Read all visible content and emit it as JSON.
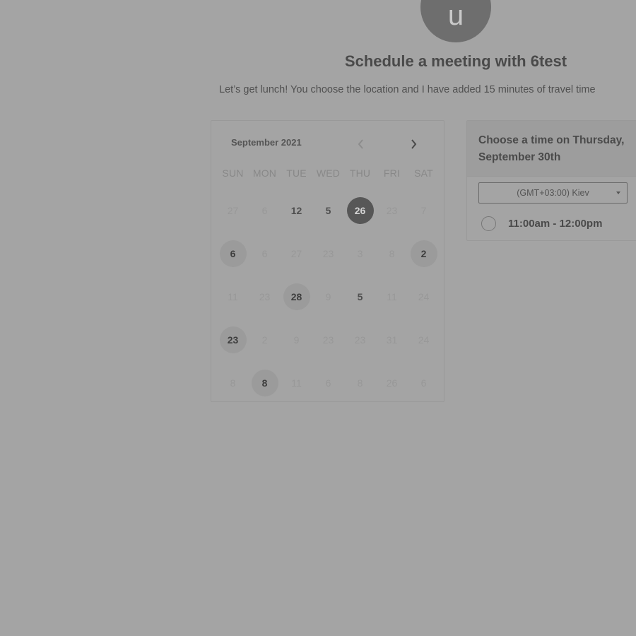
{
  "header": {
    "avatar_letter": "u",
    "title": "Schedule a meeting with 6test",
    "description": "Let’s get lunch! You choose the location and I have added 15 minutes of travel time"
  },
  "calendar": {
    "month": "September 2021",
    "prev_icon": "chevron-left-icon",
    "next_icon": "chevron-right-icon",
    "weekdays": [
      "SUN",
      "MON",
      "TUE",
      "WED",
      "THU",
      "FRI",
      "SAT"
    ],
    "weeks": [
      [
        {
          "d": "27",
          "s": "off"
        },
        {
          "d": "6",
          "s": "off"
        },
        {
          "d": "12",
          "s": "norm"
        },
        {
          "d": "5",
          "s": "norm"
        },
        {
          "d": "26",
          "s": "sel"
        },
        {
          "d": "23",
          "s": "off"
        },
        {
          "d": "7",
          "s": "off"
        }
      ],
      [
        {
          "d": "6",
          "s": "avail"
        },
        {
          "d": "6",
          "s": "off"
        },
        {
          "d": "27",
          "s": "off"
        },
        {
          "d": "23",
          "s": "off"
        },
        {
          "d": "3",
          "s": "off"
        },
        {
          "d": "8",
          "s": "off"
        },
        {
          "d": "2",
          "s": "avail"
        }
      ],
      [
        {
          "d": "11",
          "s": "off"
        },
        {
          "d": "23",
          "s": "off"
        },
        {
          "d": "28",
          "s": "avail"
        },
        {
          "d": "9",
          "s": "off"
        },
        {
          "d": "5",
          "s": "norm"
        },
        {
          "d": "11",
          "s": "off"
        },
        {
          "d": "24",
          "s": "off"
        }
      ],
      [
        {
          "d": "23",
          "s": "avail"
        },
        {
          "d": "2",
          "s": "off"
        },
        {
          "d": "9",
          "s": "off"
        },
        {
          "d": "23",
          "s": "off"
        },
        {
          "d": "23",
          "s": "off"
        },
        {
          "d": "31",
          "s": "off"
        },
        {
          "d": "24",
          "s": "off"
        }
      ],
      [
        {
          "d": "8",
          "s": "off"
        },
        {
          "d": "8",
          "s": "avail"
        },
        {
          "d": "11",
          "s": "off"
        },
        {
          "d": "6",
          "s": "off"
        },
        {
          "d": "8",
          "s": "off"
        },
        {
          "d": "26",
          "s": "off"
        },
        {
          "d": "6",
          "s": "off"
        }
      ]
    ]
  },
  "time_panel": {
    "heading": "Choose a time on Thursday, September 30th",
    "timezone": "(GMT+03:00) Kiev",
    "slots": [
      "11:00am - 12:00pm"
    ]
  },
  "colors": {
    "background": "#a4a4a4",
    "selected_day": "#575757",
    "available_day": "#9b9b9b"
  }
}
